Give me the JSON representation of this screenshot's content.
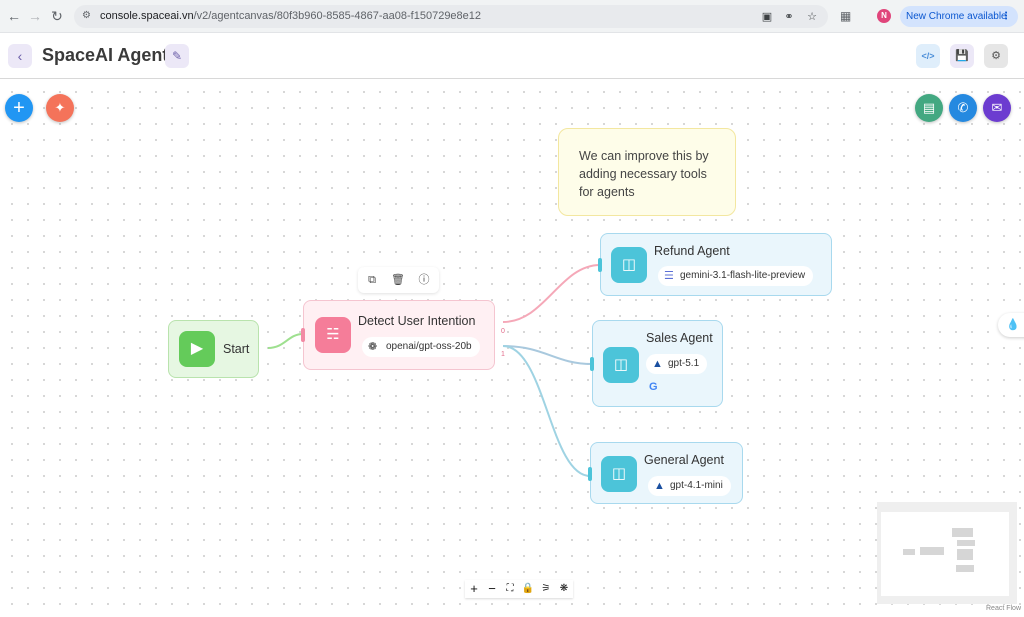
{
  "browser": {
    "url_host": "console.spaceai.vn",
    "url_path": "/v2/agentcanvas/80f3b960-8585-4867-aa08-f150729e8e12",
    "avatar_letter": "N",
    "update_label": "New Chrome available"
  },
  "header": {
    "title": "SpaceAI Agent"
  },
  "sticky_note": {
    "text": "We can improve this by adding necessary tools for agents"
  },
  "nodes": {
    "start": {
      "title": "Start"
    },
    "detect": {
      "title": "Detect User Intention",
      "model": "openai/gpt-oss-20b",
      "outputs": [
        "0",
        "1"
      ]
    },
    "refund": {
      "title": "Refund Agent",
      "model": "gemini-3.1-flash-lite-preview"
    },
    "sales": {
      "title": "Sales Agent",
      "model": "gpt-5.1"
    },
    "general": {
      "title": "General Agent",
      "model": "gpt-4.1-mini"
    }
  },
  "edge_colors": {
    "start_to_detect": "#9ee08f",
    "to_refund": "#f5a8b8",
    "to_sales": "#a9c9de",
    "to_general": "#9fd3e3"
  },
  "icons": {
    "start": "play-icon",
    "detect": "branch-icon",
    "agent": "robot-icon"
  },
  "attribution": "React Flow"
}
